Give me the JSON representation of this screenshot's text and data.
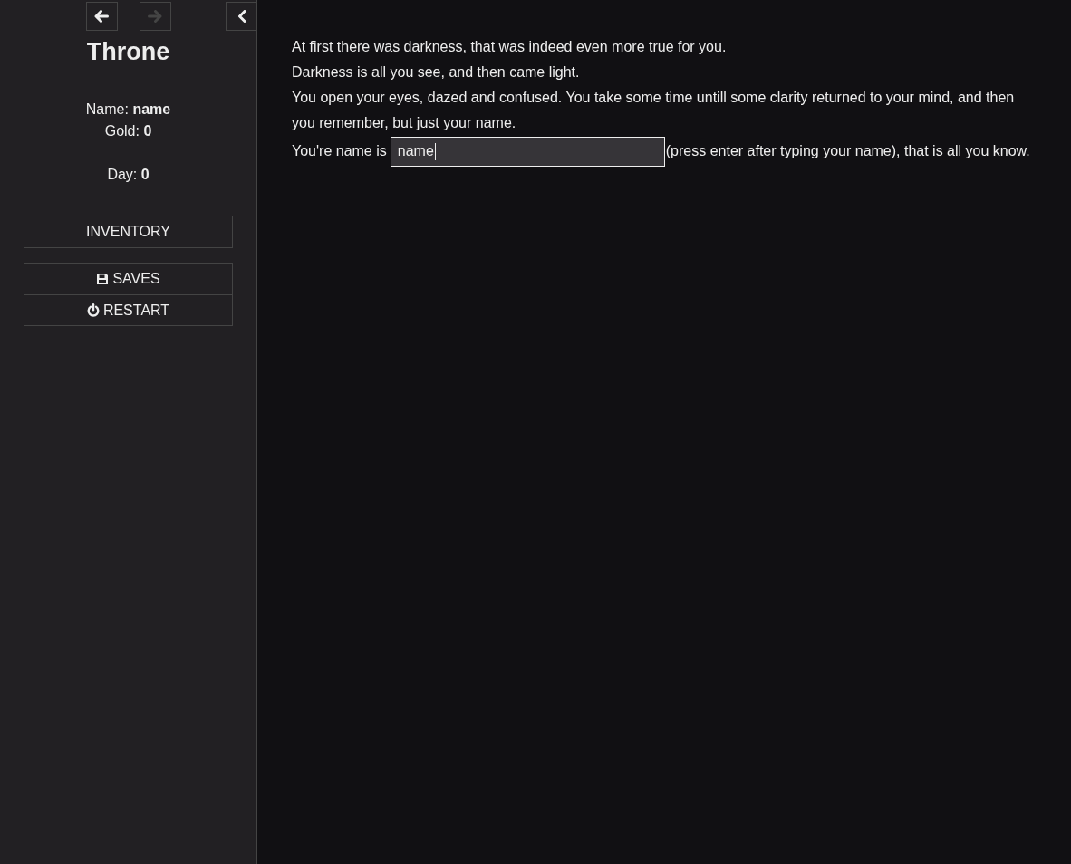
{
  "sidebar": {
    "history": [
      {
        "kind": "back",
        "disabled": false
      },
      {
        "kind": "forward",
        "disabled": true
      }
    ],
    "title": "Throne",
    "stat_groups": [
      {
        "lines": [
          "Name: **name**",
          "Gold: **0**"
        ]
      },
      {
        "lines": [
          "Day: **0**"
        ]
      }
    ],
    "menu_groups": [
      {
        "items": [
          {
            "kind": "plain",
            "label": "INVENTORY"
          }
        ]
      },
      {
        "items": [
          {
            "kind": "saves",
            "label": "SAVES"
          },
          {
            "kind": "restart",
            "label": "RESTART"
          }
        ]
      }
    ]
  },
  "passage": {
    "lines": [
      "At first there was darkness, that was indeed even more true for you.",
      "Darkness is all you see, and then came light.",
      "You open your eyes, dazed and confused. You take some time untill some clarity returned to your mind, and then you remember, but just your name."
    ],
    "prompt": {
      "before": "You're name is",
      "value": "name",
      "focused": true,
      "after": "(press enter after typing your name), that is all you know."
    }
  }
}
